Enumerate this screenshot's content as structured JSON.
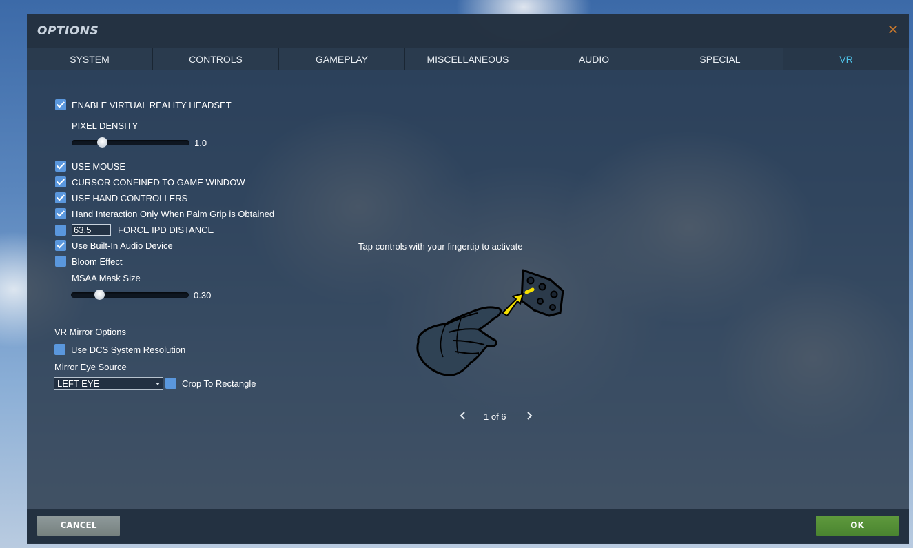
{
  "window": {
    "title": "OPTIONS",
    "close_icon": "close-icon"
  },
  "tabs": [
    {
      "label": "SYSTEM",
      "active": false
    },
    {
      "label": "CONTROLS",
      "active": false
    },
    {
      "label": "GAMEPLAY",
      "active": false
    },
    {
      "label": "MISCELLANEOUS",
      "active": false
    },
    {
      "label": "AUDIO",
      "active": false
    },
    {
      "label": "SPECIAL",
      "active": false
    },
    {
      "label": "VR",
      "active": true
    }
  ],
  "vr": {
    "enable_headset": {
      "label": "ENABLE VIRTUAL REALITY HEADSET",
      "checked": true
    },
    "pixel_density": {
      "label": "PIXEL DENSITY",
      "value": "1.0",
      "fraction": 0.26
    },
    "use_mouse": {
      "label": "USE MOUSE",
      "checked": true
    },
    "cursor_confined": {
      "label": "CURSOR CONFINED TO GAME WINDOW",
      "checked": true
    },
    "hand_controllers": {
      "label": "USE HAND CONTROLLERS",
      "checked": true
    },
    "palm_grip": {
      "label": "Hand Interaction Only When Palm Grip is Obtained",
      "checked": true
    },
    "force_ipd": {
      "label": "FORCE IPD DISTANCE",
      "checked": false,
      "value": "63.5"
    },
    "builtin_audio": {
      "label": "Use Built-In Audio Device",
      "checked": true
    },
    "bloom": {
      "label": "Bloom Effect",
      "checked": false
    },
    "msaa_mask": {
      "label": "MSAA Mask Size",
      "value": "0.30",
      "fraction": 0.24
    },
    "mirror": {
      "heading": "VR Mirror Options",
      "dcs_resolution": {
        "label": "Use DCS System Resolution",
        "checked": false
      },
      "eye_source_label": "Mirror Eye Source",
      "eye_source_value": "LEFT EYE",
      "crop": {
        "label": "Crop To Rectangle",
        "checked": false
      }
    }
  },
  "tutorial": {
    "caption": "Tap controls with your fingertip to activate",
    "page": "1 of 6",
    "illustration": "gloved-hand-tapping-panel-icon"
  },
  "footer": {
    "cancel_label": "CANCEL",
    "ok_label": "OK"
  },
  "colors": {
    "checkbox": "#5a97dd",
    "active_tab": "#4fc3e8",
    "ok_button": "#5a9439",
    "cancel_button": "#848f8e",
    "close_icon": "#c0752e"
  }
}
